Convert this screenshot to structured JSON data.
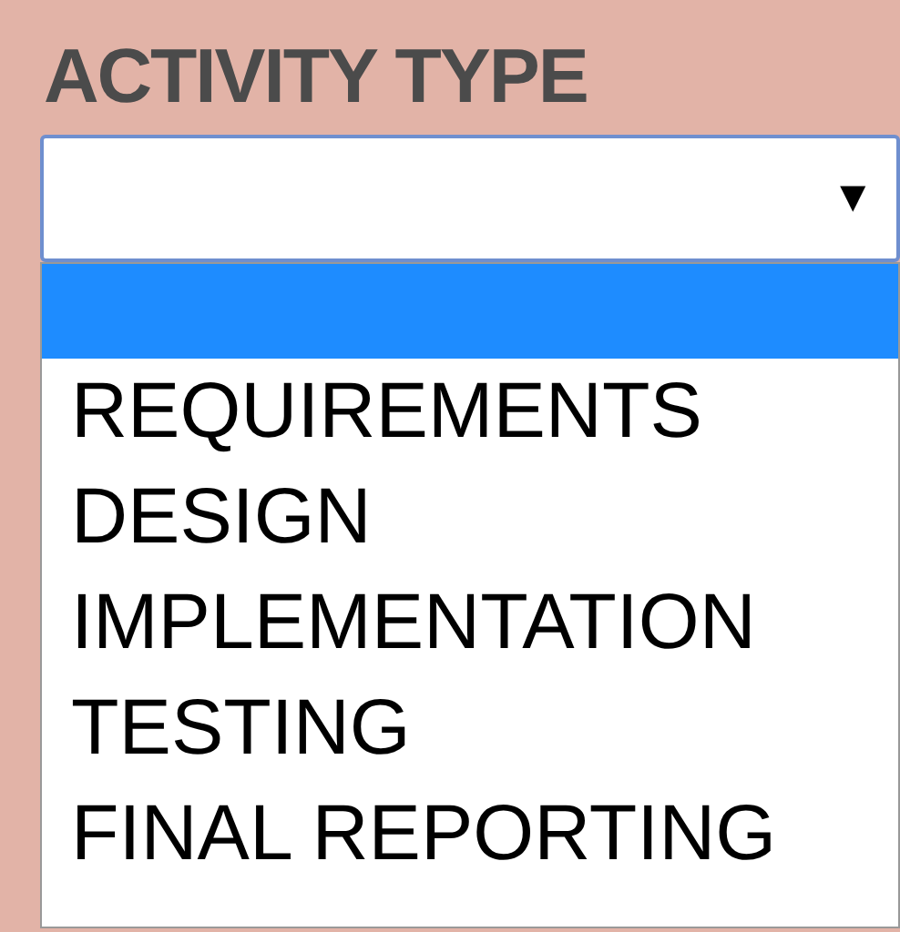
{
  "field": {
    "label": "ACTIVITY TYPE",
    "caret": "▼"
  },
  "options": [
    {
      "selected": true
    },
    {
      "label": "REQUIREMENTS",
      "selected": false
    },
    {
      "label": "DESIGN",
      "selected": false
    },
    {
      "label": "IMPLEMENTATION",
      "selected": false
    },
    {
      "label": "TESTING",
      "selected": false
    },
    {
      "label": "FINAL REPORTING",
      "selected": false
    }
  ]
}
